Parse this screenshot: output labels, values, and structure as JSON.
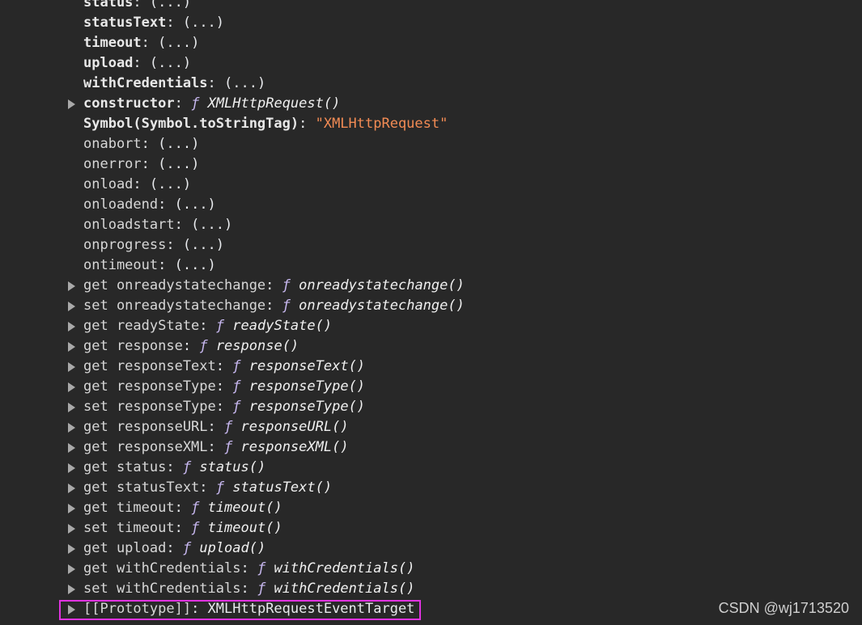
{
  "rows": [
    {
      "key": "status",
      "own": true,
      "expand": false,
      "val": "(...)"
    },
    {
      "key": "statusText",
      "own": true,
      "expand": false,
      "val": "(...)"
    },
    {
      "key": "timeout",
      "own": true,
      "expand": false,
      "val": "(...)"
    },
    {
      "key": "upload",
      "own": true,
      "expand": false,
      "val": "(...)"
    },
    {
      "key": "withCredentials",
      "own": true,
      "expand": false,
      "val": "(...)"
    },
    {
      "key": "constructor",
      "own": true,
      "expand": true,
      "f": "ƒ",
      "fn": "XMLHttpRequest()"
    },
    {
      "key": "Symbol(Symbol.toStringTag)",
      "own": true,
      "expand": false,
      "str": "\"XMLHttpRequest\""
    },
    {
      "key": "onabort",
      "own": false,
      "expand": false,
      "val": "(...)"
    },
    {
      "key": "onerror",
      "own": false,
      "expand": false,
      "val": "(...)"
    },
    {
      "key": "onload",
      "own": false,
      "expand": false,
      "val": "(...)"
    },
    {
      "key": "onloadend",
      "own": false,
      "expand": false,
      "val": "(...)"
    },
    {
      "key": "onloadstart",
      "own": false,
      "expand": false,
      "val": "(...)"
    },
    {
      "key": "onprogress",
      "own": false,
      "expand": false,
      "val": "(...)"
    },
    {
      "key": "ontimeout",
      "own": false,
      "expand": false,
      "val": "(...)"
    },
    {
      "key": "get onreadystatechange",
      "own": false,
      "expand": true,
      "f": "ƒ",
      "fn": "onreadystatechange()"
    },
    {
      "key": "set onreadystatechange",
      "own": false,
      "expand": true,
      "f": "ƒ",
      "fn": "onreadystatechange()"
    },
    {
      "key": "get readyState",
      "own": false,
      "expand": true,
      "f": "ƒ",
      "fn": "readyState()"
    },
    {
      "key": "get response",
      "own": false,
      "expand": true,
      "f": "ƒ",
      "fn": "response()"
    },
    {
      "key": "get responseText",
      "own": false,
      "expand": true,
      "f": "ƒ",
      "fn": "responseText()"
    },
    {
      "key": "get responseType",
      "own": false,
      "expand": true,
      "f": "ƒ",
      "fn": "responseType()"
    },
    {
      "key": "set responseType",
      "own": false,
      "expand": true,
      "f": "ƒ",
      "fn": "responseType()"
    },
    {
      "key": "get responseURL",
      "own": false,
      "expand": true,
      "f": "ƒ",
      "fn": "responseURL()"
    },
    {
      "key": "get responseXML",
      "own": false,
      "expand": true,
      "f": "ƒ",
      "fn": "responseXML()"
    },
    {
      "key": "get status",
      "own": false,
      "expand": true,
      "f": "ƒ",
      "fn": "status()"
    },
    {
      "key": "get statusText",
      "own": false,
      "expand": true,
      "f": "ƒ",
      "fn": "statusText()"
    },
    {
      "key": "get timeout",
      "own": false,
      "expand": true,
      "f": "ƒ",
      "fn": "timeout()"
    },
    {
      "key": "set timeout",
      "own": false,
      "expand": true,
      "f": "ƒ",
      "fn": "timeout()"
    },
    {
      "key": "get upload",
      "own": false,
      "expand": true,
      "f": "ƒ",
      "fn": "upload()"
    },
    {
      "key": "get withCredentials",
      "own": false,
      "expand": true,
      "f": "ƒ",
      "fn": "withCredentials()"
    },
    {
      "key": "set withCredentials",
      "own": false,
      "expand": true,
      "f": "ƒ",
      "fn": "withCredentials()"
    },
    {
      "key": "[[Prototype]]",
      "own": false,
      "expand": true,
      "plain": "XMLHttpRequestEventTarget"
    }
  ],
  "colors": {
    "background": "#282828",
    "highlight_box": "#e033e0",
    "string": "#f28b54",
    "function_symbol": "#c8b8f0"
  },
  "watermark": "CSDN @wj1713520"
}
